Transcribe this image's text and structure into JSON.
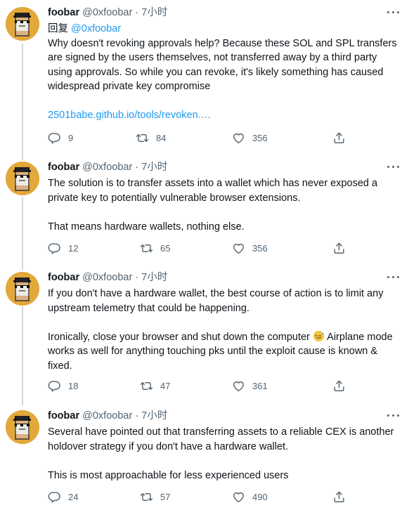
{
  "author": {
    "name": "foobar",
    "handle": "@0xfoobar",
    "dot": "·",
    "time": "7小时"
  },
  "tweets": [
    {
      "reply_prefix": "回复 ",
      "reply_handle": "@0xfoobar",
      "paragraphs": [
        "Why doesn't revoking approvals help? Because these SOL and SPL transfers are signed by the users themselves, not transferred away by a third party using approvals. So while you can revoke, it's likely something has caused widespread private key compromise"
      ],
      "link": "2501babe.github.io/tools/revoken.…",
      "replies": "9",
      "retweets": "84",
      "likes": "356"
    },
    {
      "paragraphs": [
        "The solution is to transfer assets into a wallet which has never exposed a private key to potentially vulnerable browser extensions.",
        "That means hardware wallets, nothing else."
      ],
      "replies": "12",
      "retweets": "65",
      "likes": "356"
    },
    {
      "paragraphs": [
        "If you don't have a hardware wallet, the best course of action is to limit any upstream telemetry that could be happening.",
        "Ironically, close your browser and shut down the computer",
        "Airplane mode works as well for anything touching pks until the exploit cause is known & fixed."
      ],
      "replies": "18",
      "retweets": "47",
      "likes": "361"
    },
    {
      "paragraphs": [
        "Several have pointed out that transferring assets to a reliable CEX is another holdover strategy if you don't have a hardware wallet.",
        "This is most approachable for less experienced users"
      ],
      "replies": "24",
      "retweets": "57",
      "likes": "490"
    }
  ],
  "icons": [
    "reply-icon",
    "retweet-icon",
    "like-icon",
    "share-icon",
    "more-icon",
    "grinning-sweat-emoji"
  ],
  "colors": {
    "text": "#0f1419",
    "secondary": "#536471",
    "link": "#1d9bf0",
    "thread_line": "#cfd9de",
    "avatar_bg": "#e3a83a"
  }
}
